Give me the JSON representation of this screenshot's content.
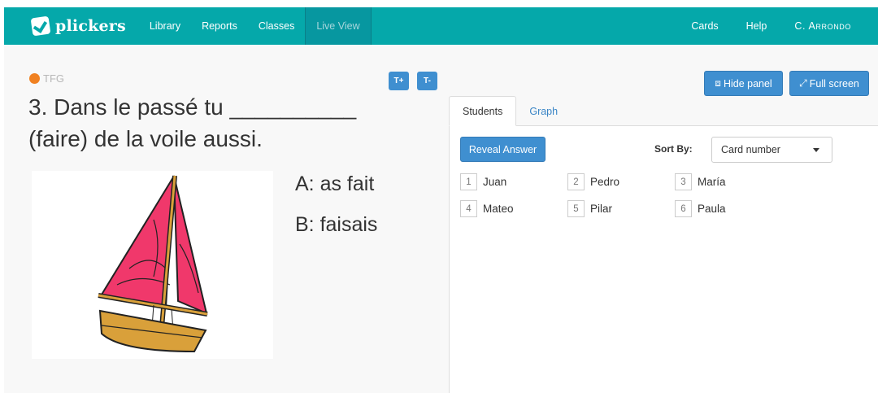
{
  "nav": {
    "brand": "plickers",
    "items": [
      {
        "label": "Library"
      },
      {
        "label": "Reports"
      },
      {
        "label": "Classes"
      },
      {
        "label": "Live View"
      }
    ],
    "right": [
      {
        "label": "Cards"
      },
      {
        "label": "Help"
      },
      {
        "label": "C. Arrondo"
      }
    ],
    "active_item": "Live View"
  },
  "question": {
    "tag": "TFG",
    "tag_color": "#f08121",
    "font_buttons": [
      "T+",
      "T-"
    ],
    "text_line1": "3. Dans le passé tu __________",
    "text_line2": "(faire) de la voile aussi.",
    "image_icon": "sailboat-image",
    "choices": [
      {
        "label": "A: as fait"
      },
      {
        "label": "B: faisais"
      }
    ]
  },
  "panel": {
    "hide_panel_label": "Hide panel",
    "full_screen_label": "Full screen",
    "tabs": [
      {
        "label": "Students"
      },
      {
        "label": "Graph"
      }
    ],
    "active_tab": "Students",
    "reveal_answer_label": "Reveal Answer",
    "sort_by_label": "Sort By:",
    "sort_by_value": "Card number",
    "students": [
      {
        "number": "1",
        "name": "Juan"
      },
      {
        "number": "2",
        "name": "Pedro"
      },
      {
        "number": "3",
        "name": "María"
      },
      {
        "number": "4",
        "name": "Mateo"
      },
      {
        "number": "5",
        "name": "Pilar"
      },
      {
        "number": "6",
        "name": "Paula"
      }
    ]
  },
  "colors": {
    "nav_bg": "#05a8aa",
    "primary_button": "#3f8fd0",
    "link": "#3a85c6"
  }
}
